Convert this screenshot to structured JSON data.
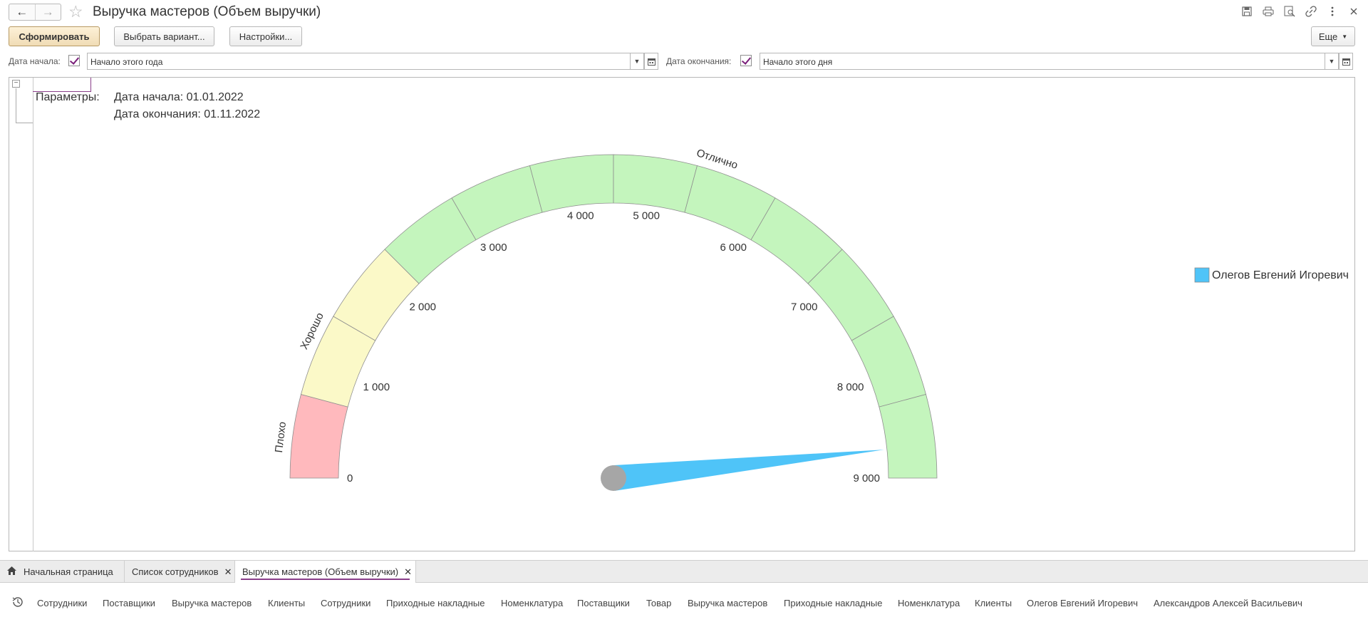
{
  "window": {
    "title": "Выручка мастеров (Объем выручки)"
  },
  "toolbar": {
    "generate_label": "Сформировать",
    "choose_variant_label": "Выбрать вариант...",
    "settings_label": "Настройки...",
    "more_label": "Еще"
  },
  "params": {
    "start_label": "Дата начала:",
    "start_value": "Начало этого года",
    "start_checked": true,
    "end_label": "Дата окончания:",
    "end_value": "Начало этого дня",
    "end_checked": true
  },
  "report": {
    "params_caption": "Параметры:",
    "start_line": "Дата начала: 01.01.2022",
    "end_line": "Дата окончания: 01.11.2022"
  },
  "chart_data": {
    "type": "gauge",
    "min": 0,
    "max": 9000,
    "tick_labels": [
      "0",
      "1 000",
      "2 000",
      "3 000",
      "4 000",
      "5 000",
      "6 000",
      "7 000",
      "8 000",
      "9 000"
    ],
    "ranges": [
      {
        "label": "Плохо",
        "from": 0,
        "to": 1000,
        "color": "#ffb9bd"
      },
      {
        "label": "Хорошо",
        "from": 1000,
        "to": 2000,
        "color": "#fbf9c8"
      },
      {
        "label": "Отлично",
        "from": 2000,
        "to": 9000,
        "color": "#c4f5bd"
      }
    ],
    "series": [
      {
        "name": "Олегов Евгений Игоревич",
        "value": 8700,
        "color": "#4fc4f8"
      }
    ],
    "legend_position": "right"
  },
  "tabs": [
    {
      "label": "Начальная страница",
      "active": false,
      "closable": false
    },
    {
      "label": "Список сотрудников",
      "active": false,
      "closable": true
    },
    {
      "label": "Выручка мастеров (Объем выручки)",
      "active": true,
      "closable": true
    }
  ],
  "history": [
    "Сотрудники",
    "Поставщики",
    "Выручка мастеров",
    "Клиенты",
    "Сотрудники",
    "Приходные накладные",
    "Номенклатура",
    "Поставщики",
    "Товар",
    "Выручка мастеров",
    "Приходные накладные",
    "Номенклатура",
    "Клиенты",
    "Олегов Евгений Игоревич",
    "Александров Алексей Васильевич"
  ]
}
